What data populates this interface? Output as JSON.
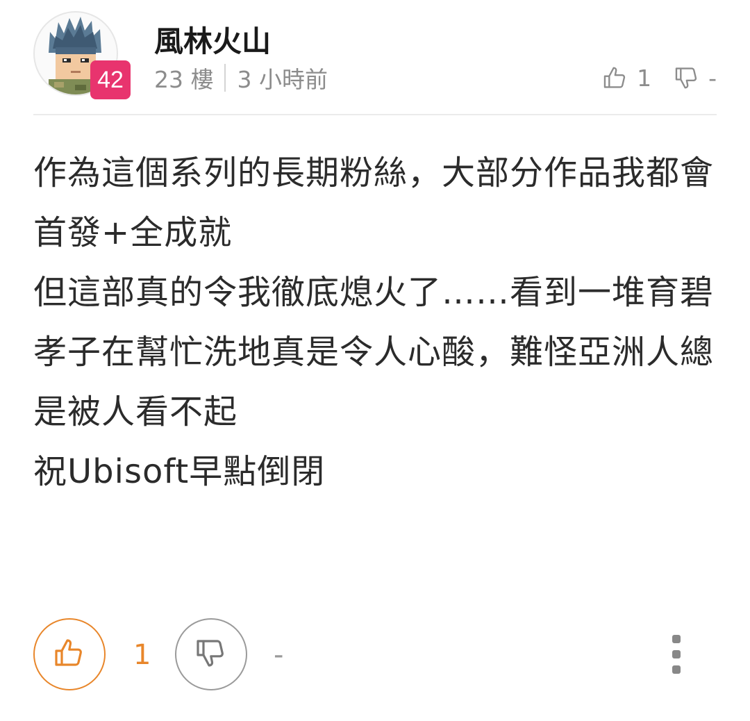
{
  "post": {
    "author": "風林火山",
    "level": "42",
    "floor": "23 樓",
    "time": "3 小時前",
    "top_like_count": "1",
    "top_dislike_count": "-",
    "body_paragraphs": [
      "作為這個系列的長期粉絲，大部分作品我都會首發+全成就",
      "但這部真的令我徹底熄火了……看到一堆育碧孝子在幫忙洗地真是令人心酸，難怪亞洲人總是被人看不起",
      "",
      "祝Ubisoft早點倒閉"
    ],
    "like_count": "1",
    "dislike_count": "-"
  },
  "colors": {
    "accent": "#e8862a",
    "badge": "#e8346e",
    "muted": "#8c8c8c",
    "text": "#2b2b2b"
  },
  "icons": {
    "avatar": "pixel-avatar-icon",
    "like": "thumbs-up-icon",
    "dislike": "thumbs-down-icon",
    "more": "more-vertical-icon"
  }
}
